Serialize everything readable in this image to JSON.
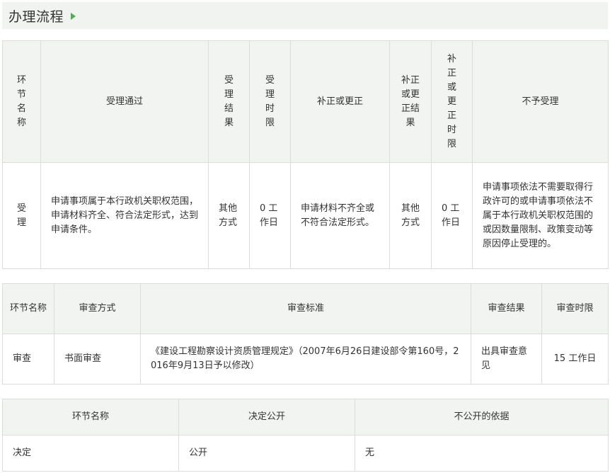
{
  "header": {
    "title": "办理流程"
  },
  "table1": {
    "headers": [
      "环节名称",
      "受理通过",
      "受理结果",
      "受理时限",
      "补正或更正",
      "补正或更正结果",
      "补正或更正时限",
      "不予受理"
    ],
    "row": [
      "受理",
      "申请事项属于本行政机关职权范围，申请材料齐全、符合法定形式，达到申请条件。",
      "其他方式",
      "0 工作日",
      "申请材料不齐全或不符合法定形式。",
      "其他方式",
      "0 工作日",
      "申请事项依法不需要取得行政许可的或申请事项依法不属于本行政机关职权范围的或因数量限制、政策变动等原因停止受理的。"
    ]
  },
  "table2": {
    "headers": [
      "环节名称",
      "审查方式",
      "审查标准",
      "审查结果",
      "审查时限"
    ],
    "row": [
      "审查",
      "书面审查",
      "《建设工程勘察设计资质管理规定》（2007年6月26日建设部令第160号，2016年9月13日予以修改）",
      "出具审查意见",
      "15 工作日"
    ]
  },
  "table3": {
    "headers": [
      "环节名称",
      "决定公开",
      "不公开的依据"
    ],
    "row": [
      "决定",
      "公开",
      "无"
    ]
  }
}
